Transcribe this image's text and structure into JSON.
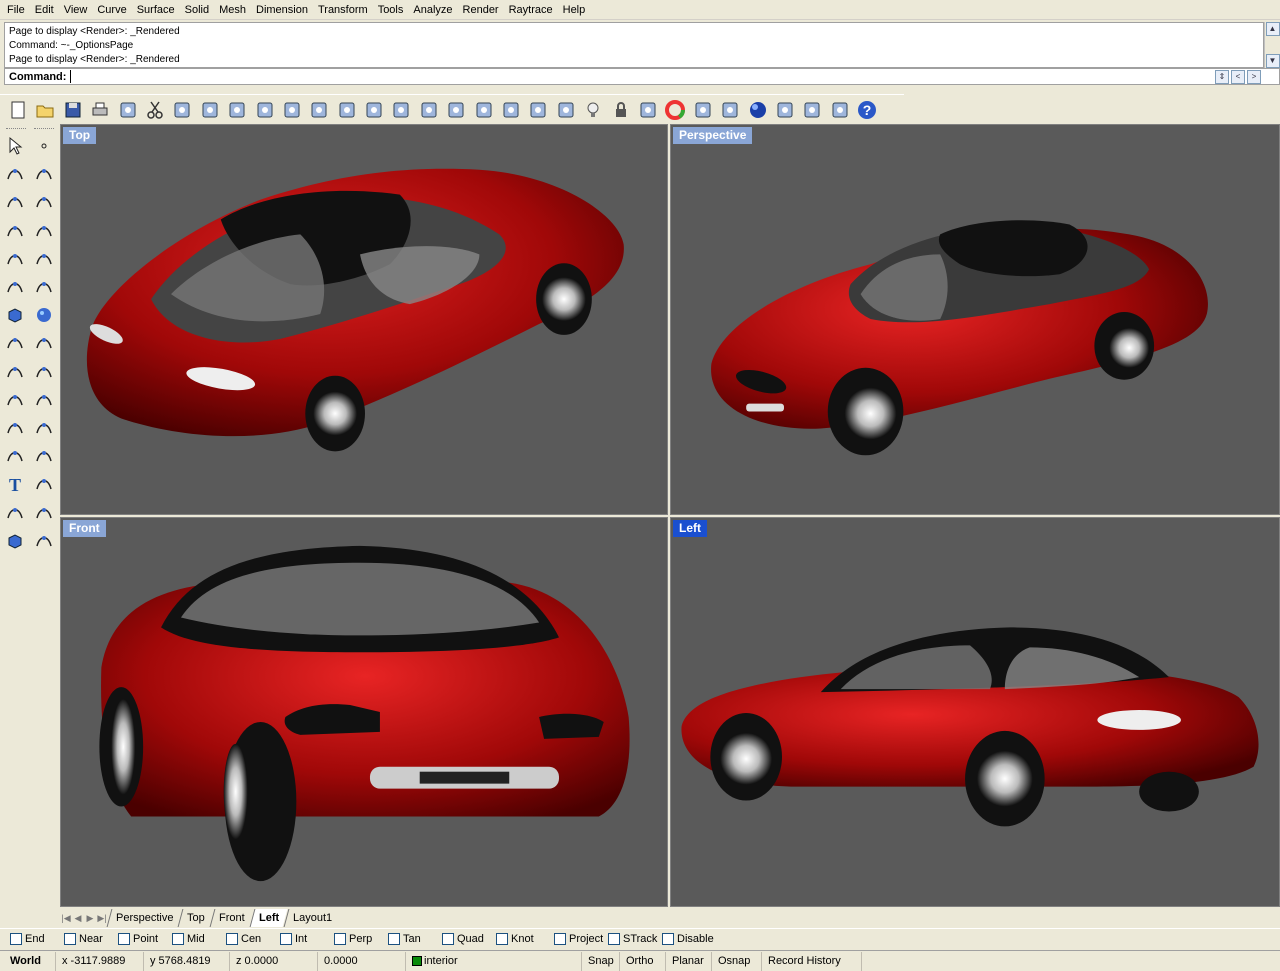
{
  "menu": [
    "File",
    "Edit",
    "View",
    "Curve",
    "Surface",
    "Solid",
    "Mesh",
    "Dimension",
    "Transform",
    "Tools",
    "Analyze",
    "Render",
    "Raytrace",
    "Help"
  ],
  "history": [
    "Page to display <Render>: _Rendered",
    "Command: ~-_OptionsPage",
    "Page to display <Render>: _Rendered"
  ],
  "command": {
    "label": "Command:",
    "value": ""
  },
  "toolbar_icons": [
    "new-file-icon",
    "open-icon",
    "save-icon",
    "print-icon",
    "import-icon",
    "cut-icon",
    "copy-icon",
    "paste-icon",
    "undo-icon",
    "pan-hand-icon",
    "rotate-view-icon",
    "zoom-dynamic-icon",
    "zoom-window-icon",
    "zoom-extents-icon",
    "zoom-selected-icon",
    "undo-view-icon",
    "four-viewports-icon",
    "car-shade-icon",
    "render-preview-icon",
    "select-point-icon",
    "select-options-icon",
    "light-bulb-icon",
    "lock-icon",
    "layers-icon",
    "color-wheel-icon",
    "material-icon",
    "sphere-render-icon",
    "blue-sphere-icon",
    "dimension-icon",
    "options-gear-icon",
    "grid-snap-icon",
    "help-icon"
  ],
  "viewports": {
    "top": "Top",
    "perspective": "Perspective",
    "front": "Front",
    "left": "Left"
  },
  "colors": {
    "car_body": "#b00c0c",
    "viewport_bg": "#5a5a5a",
    "label_inactive": "#8aa6d6",
    "label_active": "#1a4fd0"
  },
  "tabs": [
    "Perspective",
    "Top",
    "Front",
    "Left",
    "Layout1"
  ],
  "active_tab": "Left",
  "osnaps": [
    "End",
    "Near",
    "Point",
    "Mid",
    "Cen",
    "Int",
    "Perp",
    "Tan",
    "Quad",
    "Knot",
    "Project",
    "STrack",
    "Disable"
  ],
  "status": {
    "cplane": "World",
    "x": "x -3117.9889",
    "y": "y 5768.4819",
    "z": "z 0.0000",
    "distance": "0.0000",
    "layer": "interior",
    "layer_color": "#0a8a0a",
    "toggles": [
      "Snap",
      "Ortho",
      "Planar",
      "Osnap",
      "Record History"
    ]
  }
}
